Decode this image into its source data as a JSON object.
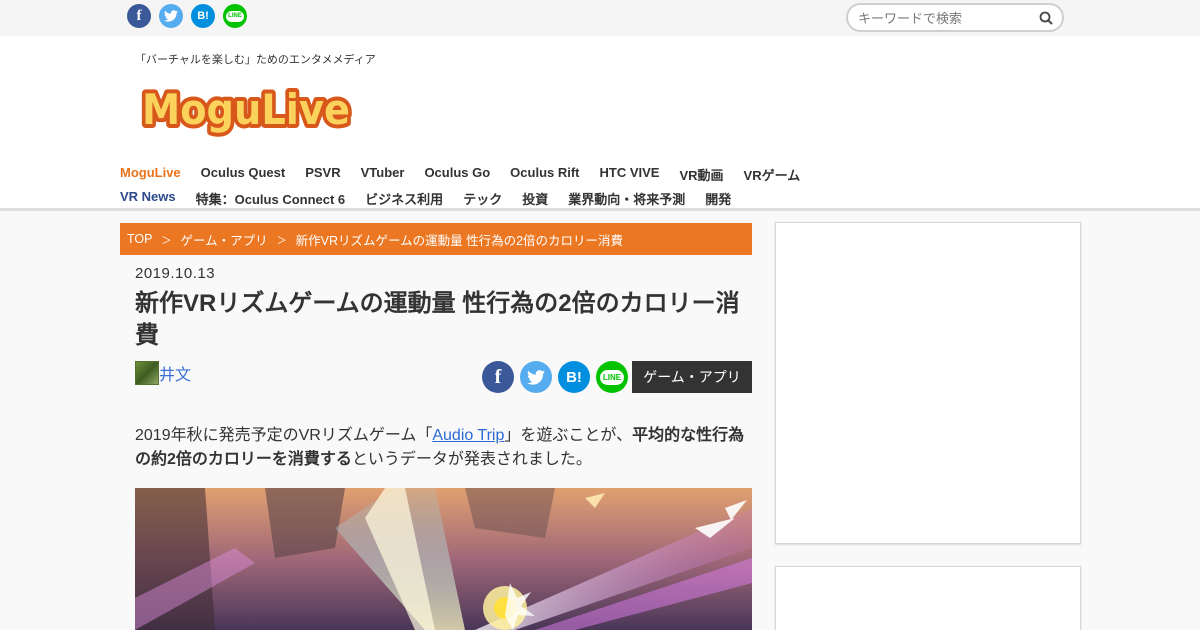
{
  "topbar": {
    "social": [
      {
        "name": "facebook",
        "glyph": "f",
        "color": "#3b5998"
      },
      {
        "name": "twitter",
        "glyph": "",
        "color": "#55acee"
      },
      {
        "name": "hatena",
        "glyph": "B!",
        "color": "#008fde"
      },
      {
        "name": "line",
        "glyph": "LINE",
        "color": "#00c300"
      }
    ],
    "search_placeholder": "キーワードで検索"
  },
  "header": {
    "tagline": "「バーチャルを楽しむ」ためのエンタメメディア",
    "logo_text": "MoguLive",
    "nav_row1": [
      "MoguLive",
      "Oculus Quest",
      "PSVR",
      "VTuber",
      "Oculus Go",
      "Oculus Rift",
      "HTC VIVE",
      "VR動画",
      "VRゲーム"
    ],
    "nav_row2": [
      "VR News",
      "特集：Oculus Connect 6",
      "ビジネス利用",
      "テック",
      "投資",
      "業界動向・将来予測",
      "開発"
    ]
  },
  "breadcrumb": {
    "items": [
      "TOP",
      "ゲーム・アプリ",
      "新作VRリズムゲームの運動量 性行為の2倍のカロリー消費"
    ],
    "separator": "＞"
  },
  "article": {
    "date": "2019.10.13",
    "title": "新作VRリズムゲームの運動量 性行為の2倍のカロリー消費",
    "author": "井文",
    "category": "ゲーム・アプリ",
    "body_prefix": "2019年秋に発売予定のVRリズムゲーム「",
    "body_link": "Audio Trip",
    "body_mid": "」を遊ぶことが、",
    "body_bold": "平均的な性行為の約2倍のカロリーを消費する",
    "body_suffix": "というデータが発表されました。"
  },
  "colors": {
    "accent": "#ec7722",
    "nav_blue": "#2c4a8c",
    "link": "#2d6ad4",
    "category_bg": "#333333"
  }
}
